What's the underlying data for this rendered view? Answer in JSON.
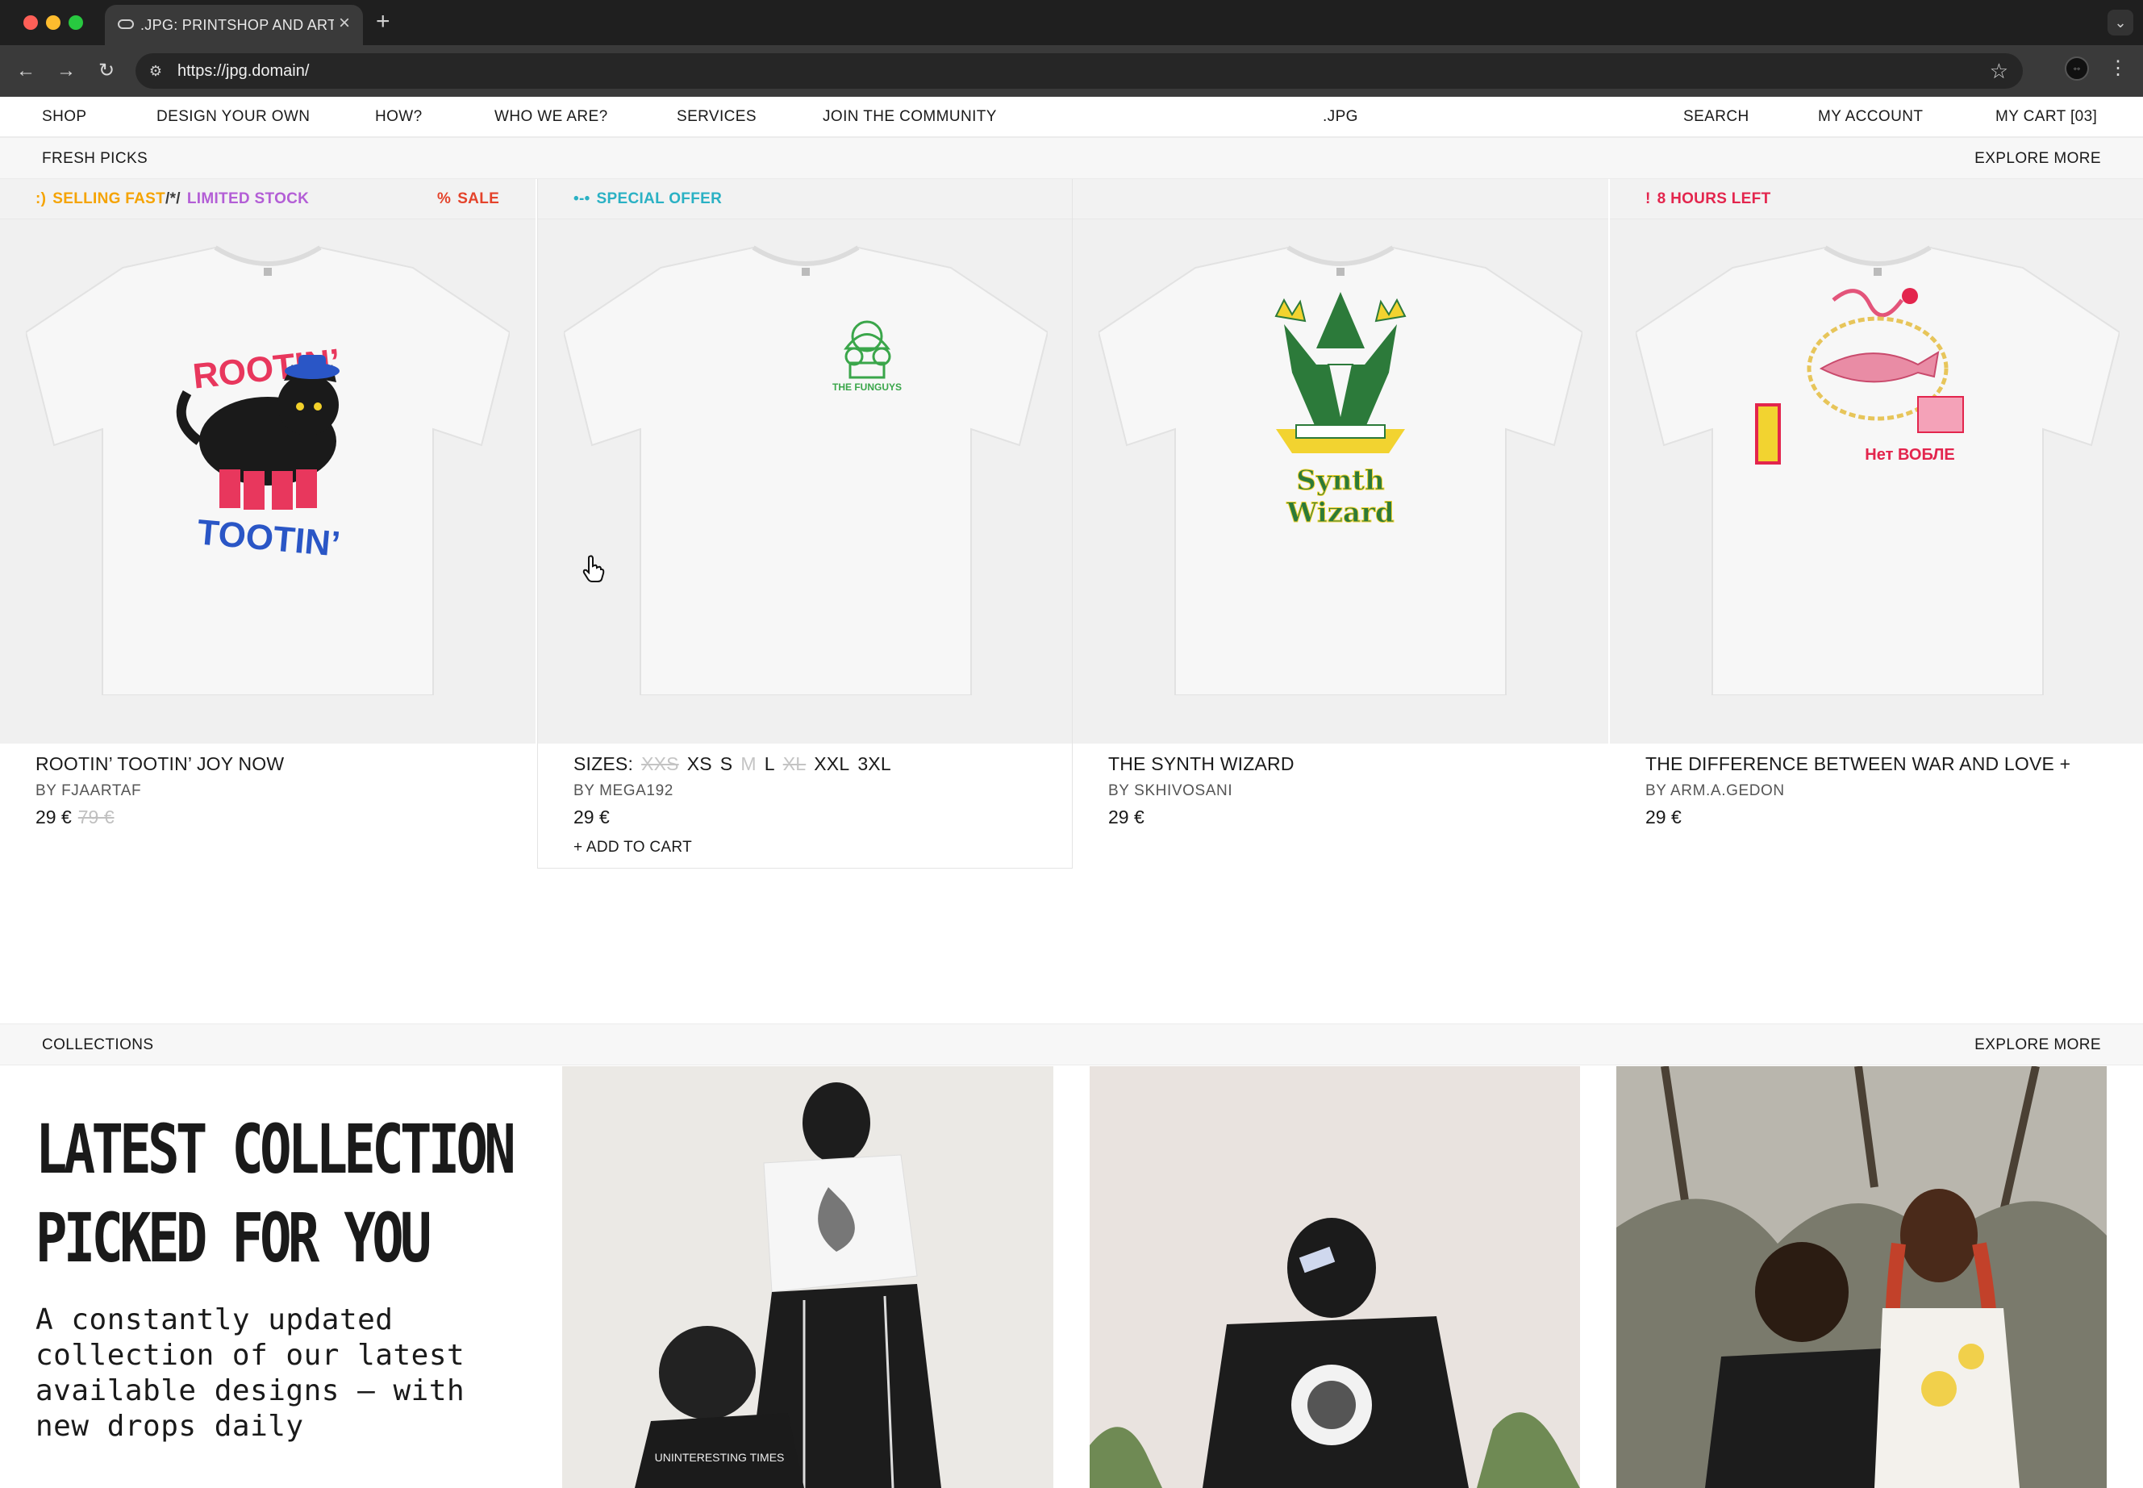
{
  "browser": {
    "tab_title": ".JPG: PRINTSHOP AND ARTIS",
    "url": "https://jpg.domain/"
  },
  "nav": {
    "shop": "SHOP",
    "design": "DESIGN YOUR OWN",
    "how": "HOW?",
    "who": "WHO WE ARE?",
    "services": "SERVICES",
    "community": "JOIN THE COMMUNITY",
    "logo": ".JPG",
    "search": "SEARCH",
    "account": "MY ACCOUNT",
    "cart": "MY CART [03]"
  },
  "fresh": {
    "label": "FRESH PICKS",
    "more": "EXPLORE MORE"
  },
  "products": [
    {
      "tags": [
        {
          "icon": ":)",
          "text": "SELLING FAST",
          "color": "#f5a300"
        },
        {
          "icon": "/*/",
          "text": "LIMITED STOCK",
          "color": "#b35ed6"
        },
        {
          "icon": "%",
          "text": "SALE",
          "color": "#e4432b"
        }
      ],
      "title": "ROOTIN’ TOOTIN’ JOY NOW",
      "by": "BY  FJAARTAF",
      "price": "29  €",
      "old_price": "79  €",
      "art_top": "ROOTIN’",
      "art_bottom": "TOOTIN’"
    },
    {
      "tags": [
        {
          "icon": "•-•",
          "text": "SPECIAL OFFER",
          "color": "#2ab1c4"
        }
      ],
      "sizes_label": "SIZES:",
      "sizes": [
        "XXS",
        "XS",
        "S",
        "M",
        "L",
        "XL",
        "XXL",
        "3XL"
      ],
      "by": "BY  MEGA192",
      "price": "29  €",
      "add_to_cart": "+ ADD TO CART",
      "art_text": "THE FUNGUYS"
    },
    {
      "title": "THE SYNTH WIZARD",
      "by": "BY  SKHIVOSANI",
      "price": "29  €",
      "art_top": "Synth",
      "art_bottom": "Wizard"
    },
    {
      "tags": [
        {
          "icon": "!",
          "text": "8 HOURS LEFT",
          "color": "#e3254d"
        }
      ],
      "title": "THE DIFFERENCE BETWEEN WAR AND LOVE +",
      "by": "BY  ARM.A.GEDON",
      "price": "29  €",
      "art_text": "Нет ВОБЛЕ"
    }
  ],
  "collections": {
    "label": "COLLECTIONS",
    "more": "EXPLORE MORE",
    "headline_1": "LATEST COLLECTION",
    "headline_2": "PICKED FOR YOU",
    "description": "A constantly updated collection of our latest available designs — with new drops daily",
    "photo1_print": "UNINTERESTING TIMES"
  }
}
